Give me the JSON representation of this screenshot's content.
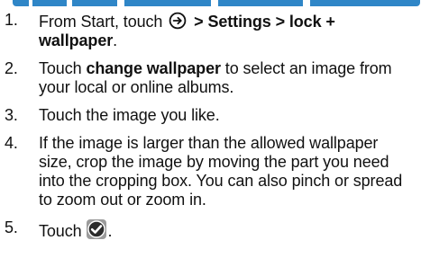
{
  "header_fragment": "",
  "steps": [
    {
      "number": "1.",
      "text_before_icon": "From Start, touch",
      "icon_name": "arrow-circle-icon",
      "text_after_icon": " > Settings > lock + wallpaper",
      "text_end": "."
    },
    {
      "number": "2.",
      "prefix": "Touch ",
      "bold": "change wallpaper",
      "suffix": " to select an image from your local or online albums."
    },
    {
      "number": "3.",
      "text": "Touch the image you like."
    },
    {
      "number": "4.",
      "text": "If the image is larger than the allowed wallpaper size, crop the image by moving the part you need into the cropping box. You can also pinch or spread to zoom out or zoom in."
    },
    {
      "number": "5.",
      "prefix": "Touch ",
      "icon_name": "check-circle-icon",
      "suffix": "."
    }
  ],
  "colors": {
    "text": "#111111",
    "check_badge": "#2c2c2c",
    "header_fragment": "#2f86c7"
  }
}
